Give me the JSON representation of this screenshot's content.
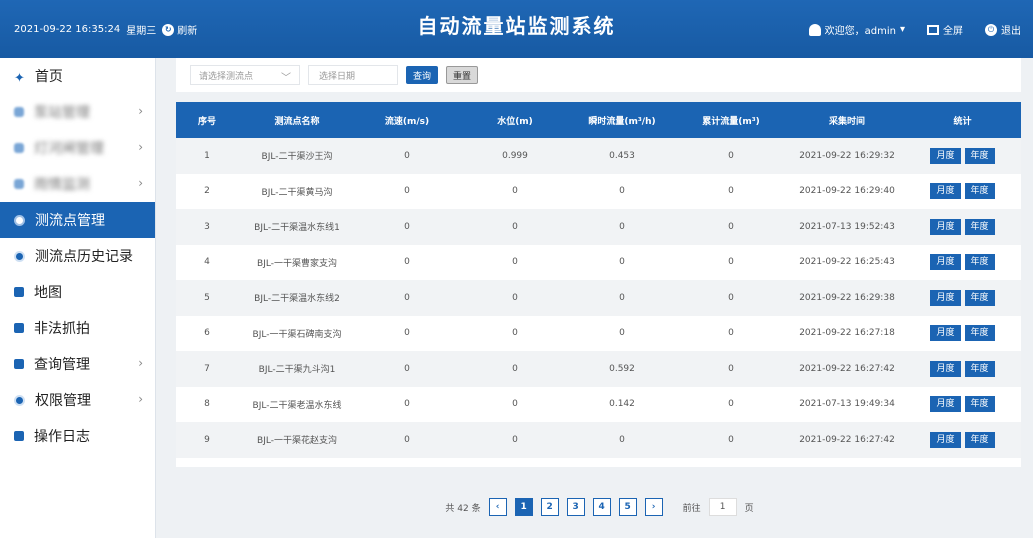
{
  "header": {
    "datetime": "2021-09-22  16:35:24",
    "weekday": "星期三",
    "refresh_label": "刷新",
    "title": "自动流量站监测系统",
    "welcome": "欢迎您，admin",
    "fullscreen_label": "全屏",
    "logout_label": "退出"
  },
  "sidebar": {
    "items": [
      {
        "label": "首页",
        "icon": "home-icon"
      },
      {
        "label": "泵站管理",
        "icon": "blurred-icon",
        "blurred": true,
        "chevron": true
      },
      {
        "label": "灯河闸管理",
        "icon": "blurred-icon",
        "blurred": true,
        "chevron": true
      },
      {
        "label": "雨情监测",
        "icon": "blurred-icon",
        "blurred": true,
        "chevron": true
      },
      {
        "label": "测流点管理",
        "icon": "dot-icon",
        "active": true
      },
      {
        "label": "测流点历史记录",
        "icon": "dot-icon"
      },
      {
        "label": "地图",
        "icon": "map-icon"
      },
      {
        "label": "非法抓拍",
        "icon": "camera-icon"
      },
      {
        "label": "查询管理",
        "icon": "query-icon",
        "chevron": true
      },
      {
        "label": "权限管理",
        "icon": "shield-icon",
        "chevron": true
      },
      {
        "label": "操作日志",
        "icon": "log-icon"
      }
    ]
  },
  "filter": {
    "point_placeholder": "请选择测流点",
    "date_placeholder": "选择日期",
    "query_label": "查询",
    "reset_label": "重置"
  },
  "table": {
    "headers": [
      "序号",
      "测流点名称",
      "流速(m/s)",
      "水位(m)",
      "瞬时流量(m³/h)",
      "累计流量(m³)",
      "采集时间",
      "统计"
    ],
    "month_label": "月度",
    "year_label": "年度",
    "rows": [
      [
        "1",
        "BJL-二干渠沙王沟",
        "0",
        "0.999",
        "0.453",
        "0",
        "2021-09-22 16:29:32"
      ],
      [
        "2",
        "BJL-二干渠黄马沟",
        "0",
        "0",
        "0",
        "0",
        "2021-09-22 16:29:40"
      ],
      [
        "3",
        "BJL-二干渠温水东线1",
        "0",
        "0",
        "0",
        "0",
        "2021-07-13 19:52:43"
      ],
      [
        "4",
        "BJL-一干渠曹家支沟",
        "0",
        "0",
        "0",
        "0",
        "2021-09-22 16:25:43"
      ],
      [
        "5",
        "BJL-二干渠温水东线2",
        "0",
        "0",
        "0",
        "0",
        "2021-09-22 16:29:38"
      ],
      [
        "6",
        "BJL-一干渠石碑南支沟",
        "0",
        "0",
        "0",
        "0",
        "2021-09-22 16:27:18"
      ],
      [
        "7",
        "BJL-二干渠九斗沟1",
        "0",
        "0",
        "0.592",
        "0",
        "2021-09-22 16:27:42"
      ],
      [
        "8",
        "BJL-二干渠老温水东线",
        "0",
        "0",
        "0.142",
        "0",
        "2021-07-13 19:49:34"
      ],
      [
        "9",
        "BJL-一干渠花赵支沟",
        "0",
        "0",
        "0",
        "0",
        "2021-09-22 16:27:42"
      ]
    ]
  },
  "pager": {
    "total": "共 42 条",
    "prev": "‹",
    "next": "›",
    "pages": [
      "1",
      "2",
      "3",
      "4",
      "5"
    ],
    "current": "1",
    "goto_label": "前往",
    "goto_value": "1",
    "page_unit": "页"
  }
}
